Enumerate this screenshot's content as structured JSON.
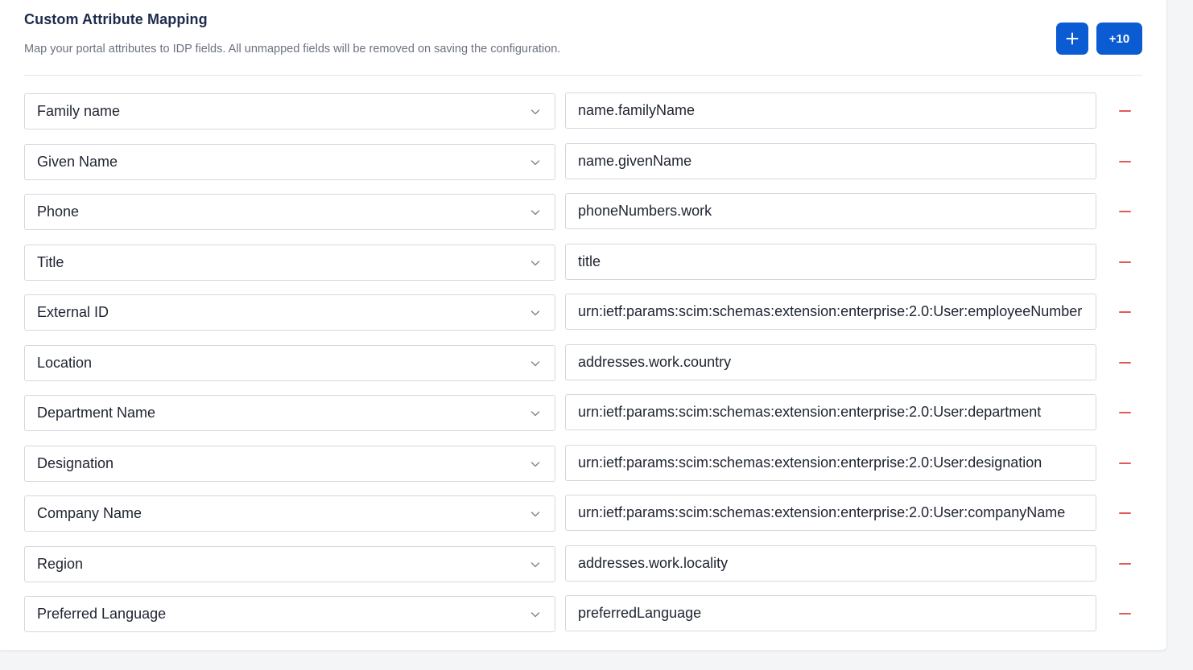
{
  "header": {
    "title": "Custom Attribute Mapping",
    "subtitle": "Map your portal attributes to IDP fields. All unmapped fields will be removed on saving the configuration.",
    "add_icon": "plus-icon",
    "add10_label": "+10"
  },
  "colors": {
    "primary": "#0b5bd3",
    "remove": "#e05a5a",
    "title": "#1d2b4c"
  },
  "mappings": [
    {
      "attribute": "Family name",
      "idp_field": "name.familyName"
    },
    {
      "attribute": "Given Name",
      "idp_field": "name.givenName"
    },
    {
      "attribute": "Phone",
      "idp_field": "phoneNumbers.work"
    },
    {
      "attribute": "Title",
      "idp_field": "title"
    },
    {
      "attribute": "External ID",
      "idp_field": "urn:ietf:params:scim:schemas:extension:enterprise:2.0:User:employeeNumber"
    },
    {
      "attribute": "Location",
      "idp_field": "addresses.work.country"
    },
    {
      "attribute": "Department Name",
      "idp_field": "urn:ietf:params:scim:schemas:extension:enterprise:2.0:User:department"
    },
    {
      "attribute": "Designation",
      "idp_field": "urn:ietf:params:scim:schemas:extension:enterprise:2.0:User:designation"
    },
    {
      "attribute": "Company Name",
      "idp_field": "urn:ietf:params:scim:schemas:extension:enterprise:2.0:User:companyName"
    },
    {
      "attribute": "Region",
      "idp_field": "addresses.work.locality"
    },
    {
      "attribute": "Preferred Language",
      "idp_field": "preferredLanguage"
    }
  ]
}
